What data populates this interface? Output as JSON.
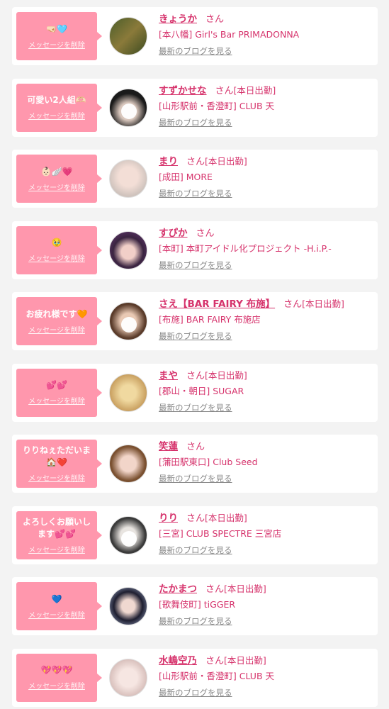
{
  "delete_label": "メッセージを削除",
  "blog_label": "最新のブログを見る",
  "san_label": "さん",
  "items": [
    {
      "message": "🤜🏻🩵",
      "name": "きょうか",
      "status": "",
      "shop": "[本八幡] Girl's Bar PRIMADONNA",
      "avatar_bg": "linear-gradient(135deg,#4b5d2a,#8a7a3a 50%,#3b4a20)"
    },
    {
      "message": "可愛い2人組🫶🏻",
      "name": "すずかせな",
      "status": "[本日出勤]",
      "shop": "[山形駅前・香澄町] CLUB 天",
      "avatar_bg": "radial-gradient(circle at 50% 60%,#d9c7bd 30%,#1a1a1a 62%)"
    },
    {
      "message": "👶🏻🪽💗",
      "name": "まり",
      "status": "[本日出勤]",
      "shop": "[成田] MORE",
      "avatar_bg": "radial-gradient(circle at 50% 45%,#f3ded6 35%,#cfc3bd 70%)"
    },
    {
      "message": "🥹",
      "name": "すぴか",
      "status": "",
      "shop": "[本町] 本町アイドル化プロジェクト -H.i.P.-",
      "avatar_bg": "radial-gradient(circle at 50% 55%,#f1cfc8 25%,#3a2440 55%,#6a3a7a)"
    },
    {
      "message": "お疲れ様です🧡",
      "name": "さえ【BAR FAIRY 布施】",
      "status": "[本日出勤]",
      "shop": "[布施] BAR FAIRY 布施店",
      "avatar_bg": "radial-gradient(circle at 50% 50%,#e9c9b4 30%,#5a3b2a 65%)"
    },
    {
      "message": "💕💕",
      "name": "まや",
      "status": "[本日出勤]",
      "shop": "[郡山・朝日] SUGAR",
      "avatar_bg": "radial-gradient(circle at 50% 50%,#f0d9a0 30%,#c9a060 70%)"
    },
    {
      "message": "りりねぇただいま🏠❤️",
      "name": "笑蓮",
      "status": "",
      "shop": "[蒲田駅東口] Club Seed",
      "avatar_bg": "radial-gradient(circle at 50% 50%,#f2d5c9 30%,#7a5030 65%)"
    },
    {
      "message": "よろしくお願いします💕💕",
      "name": "りり",
      "status": "[本日出勤]",
      "shop": "[三宮] CLUB SPECTRE 三宮店",
      "avatar_bg": "radial-gradient(circle at 50% 50%,#e8e4e0 30%,#3a3a3a 65%)"
    },
    {
      "message": "💙",
      "name": "たかまつ",
      "status": "[本日出勤]",
      "shop": "[歌舞伎町] tiGGER",
      "avatar_bg": "radial-gradient(circle at 50% 50%,#f0d8d0 25%,#1e1e30 55%,#aab8d8)"
    },
    {
      "message": "💖💖💖",
      "name": "水嶋空乃",
      "status": "[本日出勤]",
      "shop": "[山形駅前・香澄町] CLUB 天",
      "avatar_bg": "radial-gradient(circle at 50% 50%,#f6e6e2 35%,#d9c1bd 70%)"
    }
  ]
}
